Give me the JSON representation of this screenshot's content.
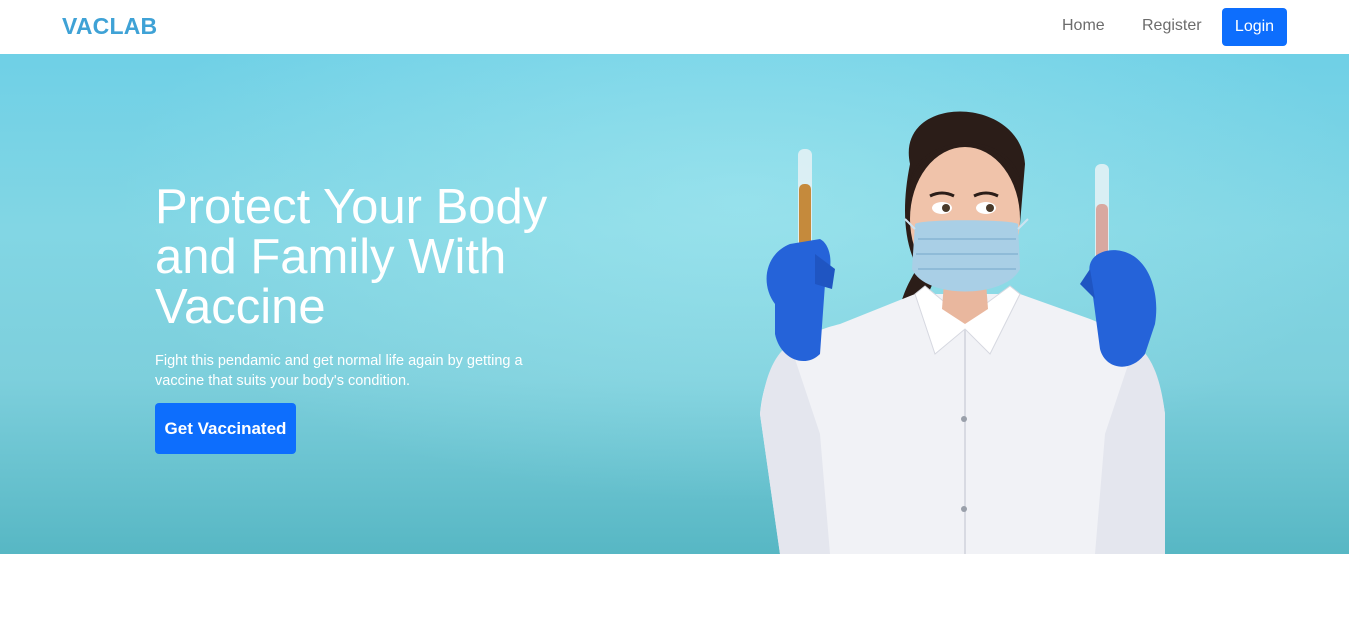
{
  "navbar": {
    "brand": "VACLAB",
    "links": [
      {
        "label": "Home"
      },
      {
        "label": "Register"
      }
    ],
    "login_label": "Login"
  },
  "hero": {
    "title": "Protect Your Body and Family With Vaccine",
    "subtitle": "Fight this pendamic and get normal life again by getting a vaccine that suits your body's condition.",
    "cta_label": "Get Vaccinated",
    "image_description": "scientist-with-test-tubes"
  },
  "colors": {
    "brand": "#3fa2d6",
    "primary": "#0d6efd",
    "hero_bg": "#7fd3e2",
    "nav_text": "#6c6c6c"
  }
}
